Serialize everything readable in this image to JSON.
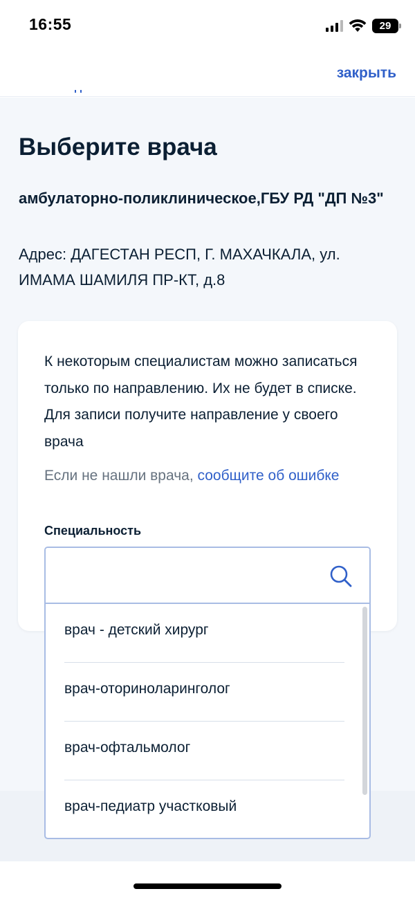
{
  "status_bar": {
    "time": "16:55",
    "battery": "29",
    "icons": [
      "signal-icon",
      "wifi-icon",
      "battery-icon"
    ]
  },
  "header": {
    "close_label": "закрыть"
  },
  "page": {
    "title": "Выберите врача",
    "organization": "амбулаторно-поликлиническое,ГБУ РД \"ДП №3\"",
    "address": "Адрес: ДАГЕСТАН РЕСП, Г. МАХАЧКАЛА, ул. ИМАМА ШАМИЛЯ ПР-КТ, д.8"
  },
  "card": {
    "notice": "К некоторым специалистам можно записаться только по направлению. Их не будет в списке. Для записи получите направление у своего врача",
    "hint_prefix": "Если не нашли врача,",
    "hint_link": "сообщите об ошибке",
    "specialty_label": "Специальность"
  },
  "search": {
    "value": "",
    "placeholder": "",
    "icon": "search-icon"
  },
  "dropdown": {
    "items": [
      {
        "label": "врач - детский хирург"
      },
      {
        "label": "врач-оториноларинголог"
      },
      {
        "label": "врач-офтальмолог"
      },
      {
        "label": "врач-педиатр участковый"
      }
    ]
  },
  "colors": {
    "accent": "#3060c9",
    "text": "#0b1f33",
    "muted": "#66727f",
    "background": "#f4f7fb",
    "input_border": "#a8bce4"
  }
}
